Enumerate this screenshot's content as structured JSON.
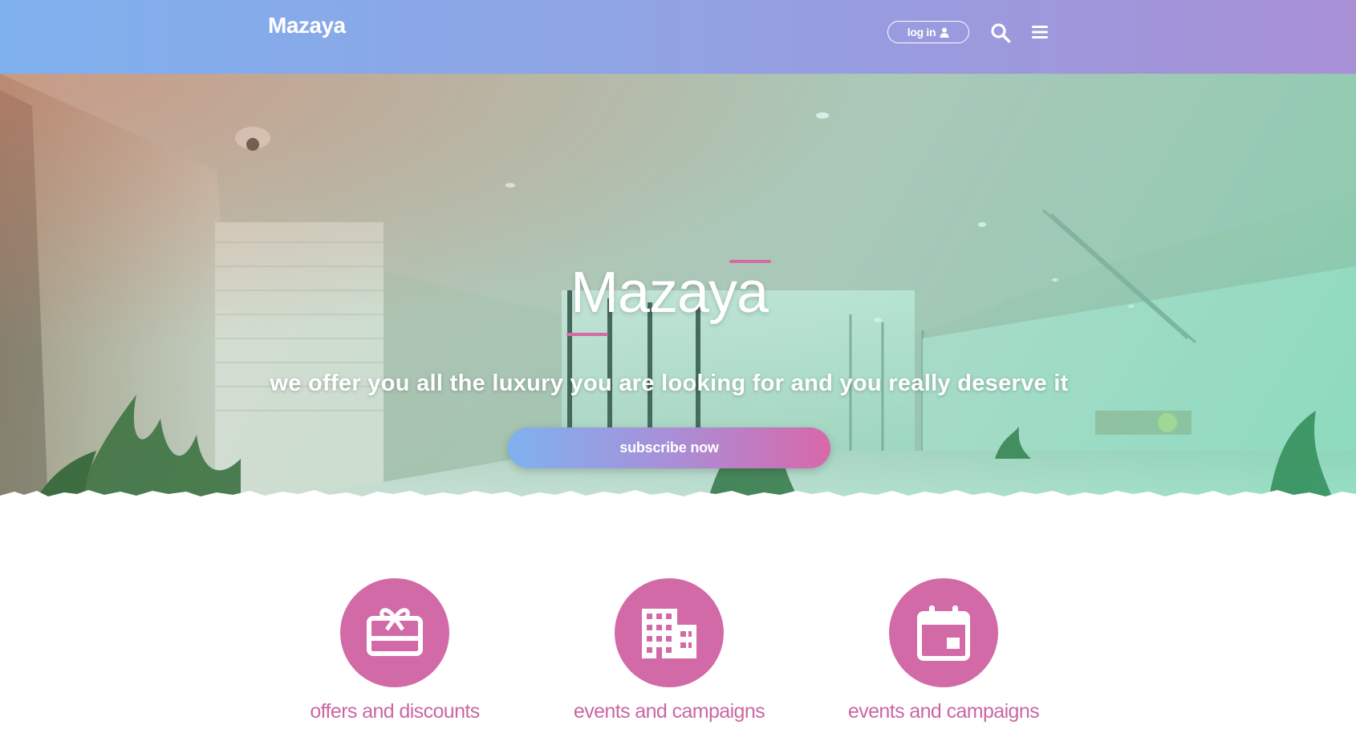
{
  "header": {
    "brand": "Mazaya",
    "login_label": "log in",
    "icons": [
      "user-icon",
      "search-icon",
      "hamburger-menu-icon"
    ]
  },
  "hero": {
    "title": "Mazaya",
    "tagline": "we offer you all the luxury you are looking for and you really deserve it",
    "cta_label": "subscribe now"
  },
  "features": [
    {
      "label": "offers and discounts",
      "icon": "gift-card-icon"
    },
    {
      "label": "events and campaigns",
      "icon": "building-icon"
    },
    {
      "label": "events and campaigns",
      "icon": "calendar-icon"
    }
  ],
  "colors": {
    "header_gradient_start": "#7fb0ee",
    "header_gradient_end": "#a88fd6",
    "accent_pink": "#d36aa8",
    "feature_label": "#cc66a3"
  }
}
